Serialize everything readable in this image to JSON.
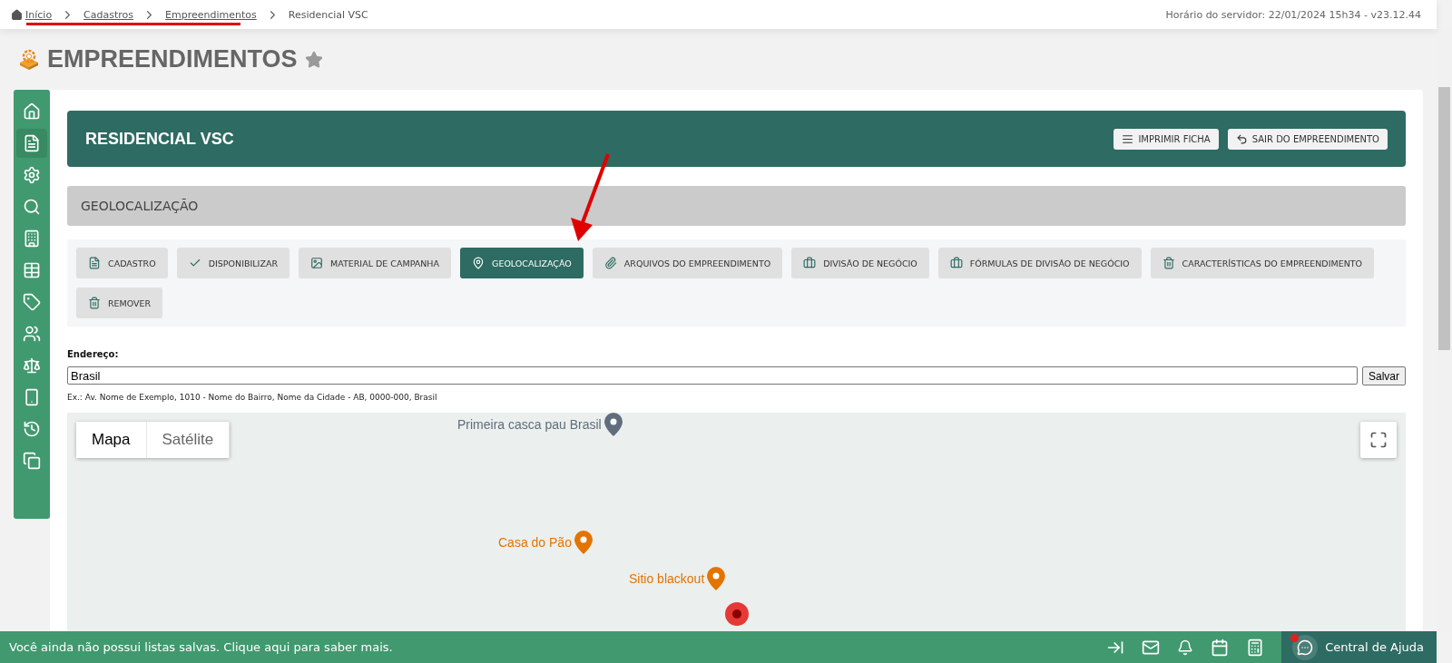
{
  "breadcrumb": [
    {
      "label": "Início",
      "link": true
    },
    {
      "label": "Cadastros",
      "link": true
    },
    {
      "label": "Empreendimentos",
      "link": true
    },
    {
      "label": "Residencial VSC",
      "link": false
    }
  ],
  "server_time": "Horário do servidor: 22/01/2024 15h34 - v23.12.44",
  "page_title": "EMPREENDIMENTOS",
  "sidebar": {
    "items": [
      {
        "selected": false
      },
      {
        "selected": true
      },
      {
        "selected": false
      },
      {
        "selected": false
      },
      {
        "selected": false
      },
      {
        "selected": false
      },
      {
        "selected": false
      },
      {
        "selected": false
      },
      {
        "selected": false
      },
      {
        "selected": false
      },
      {
        "selected": false
      },
      {
        "selected": false
      }
    ]
  },
  "header": {
    "title": "RESIDENCIAL VSC",
    "buttons": [
      "IMPRIMIR FICHA",
      "SAIR DO EMPREENDIMENTO"
    ]
  },
  "section_title": "GEOLOCALIZAÇÃO",
  "tabs": [
    {
      "label": "CADASTRO",
      "selected": false
    },
    {
      "label": "DISPONIBILIZAR",
      "selected": false
    },
    {
      "label": "MATERIAL DE CAMPANHA",
      "selected": false
    },
    {
      "label": "GEOLOCALIZAÇÃO",
      "selected": true
    },
    {
      "label": "ARQUIVOS DO EMPREENDIMENTO",
      "selected": false
    },
    {
      "label": "DIVISÃO DE NEGÓCIO",
      "selected": false
    },
    {
      "label": "FÓRMULAS DE DIVISÃO DE NEGÓCIO",
      "selected": false
    },
    {
      "label": "CARACTERÍSTICAS DO EMPREENDIMENTO",
      "selected": false
    },
    {
      "label": "REMOVER",
      "selected": false
    }
  ],
  "address": {
    "label": "Endereço:",
    "value": "Brasil",
    "button": "Salvar",
    "hint": "Ex.: Av. Nome de Exemplo, 1010 - Nome do Bairro, Nome da Cidade - AB, 0000-000, Brasil"
  },
  "map": {
    "types": [
      {
        "label": "Mapa",
        "selected": true
      },
      {
        "label": "Satélite",
        "selected": false
      }
    ],
    "places": [
      {
        "label": "Primeira casca pau Brasil",
        "color": "#5f6d7c"
      },
      {
        "label": "Casa do Pão",
        "color": "#e37400"
      },
      {
        "label": "Sitio blackout",
        "color": "#e37400"
      }
    ]
  },
  "bottom_bar": {
    "message": "Você ainda não possui listas salvas. Clique aqui para saber mais.",
    "help": "Central de Ajuda",
    "help_notification": true
  }
}
